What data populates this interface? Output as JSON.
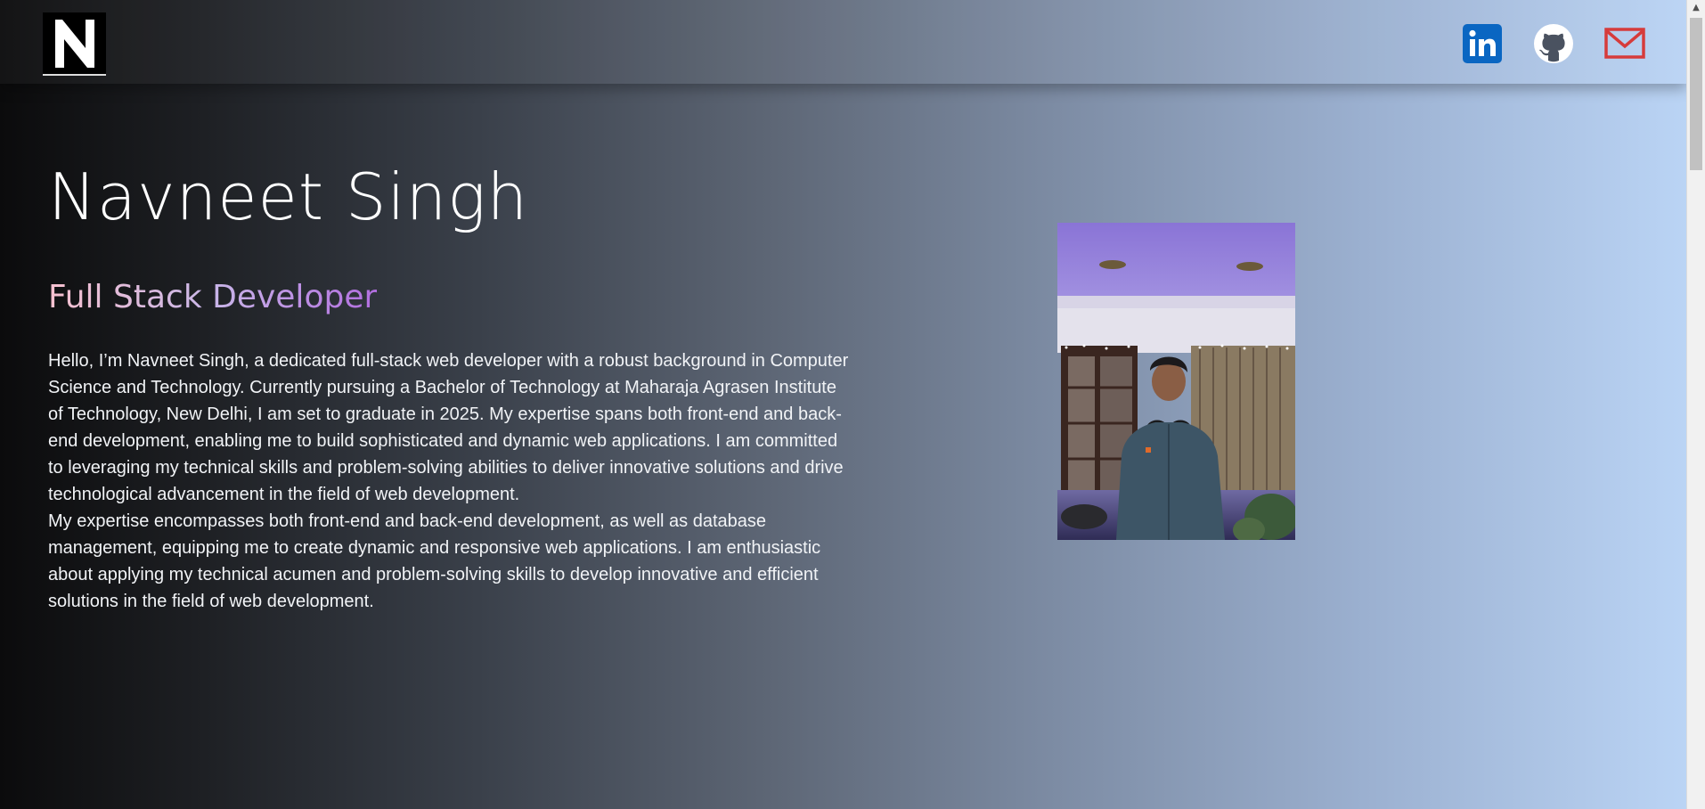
{
  "nav": {
    "logo_icon": "n-logo-icon",
    "social": [
      {
        "name": "LinkedIn",
        "icon": "linkedin-icon",
        "color": "#0a66c2"
      },
      {
        "name": "GitHub",
        "icon": "github-icon",
        "color": "#ffffff"
      },
      {
        "name": "Email",
        "icon": "mail-icon",
        "color": "#d63b3b"
      }
    ]
  },
  "hero": {
    "name": "Navneet Singh",
    "role": "Full Stack Developer",
    "bio_paragraph_1": "Hello, I’m Navneet Singh, a dedicated full-stack web developer with a robust background in Computer Science and Technology. Currently pursuing a Bachelor of Technology at Maharaja Agrasen Institute of Technology, New Delhi, I am set to graduate in 2025. My expertise spans both front-end and back-end development, enabling me to build sophisticated and dynamic web applications. I am committed to leveraging my technical skills and problem-solving abilities to deliver innovative solutions and drive technological advancement in the field of web development.",
    "bio_paragraph_2": "My expertise encompasses both front-end and back-end development, as well as database management, equipping me to create dynamic and responsive web applications. I am enthusiastic about applying my technical acumen and problem-solving skills to develop innovative and efficient solutions in the field of web development.",
    "photo_icon": "profile-photo"
  },
  "colors": {
    "role_gradient_start": "#f6c1cf",
    "role_gradient_end": "#b26ee0",
    "background_left": "#0b0b0c",
    "background_right": "#bcd6f7"
  }
}
